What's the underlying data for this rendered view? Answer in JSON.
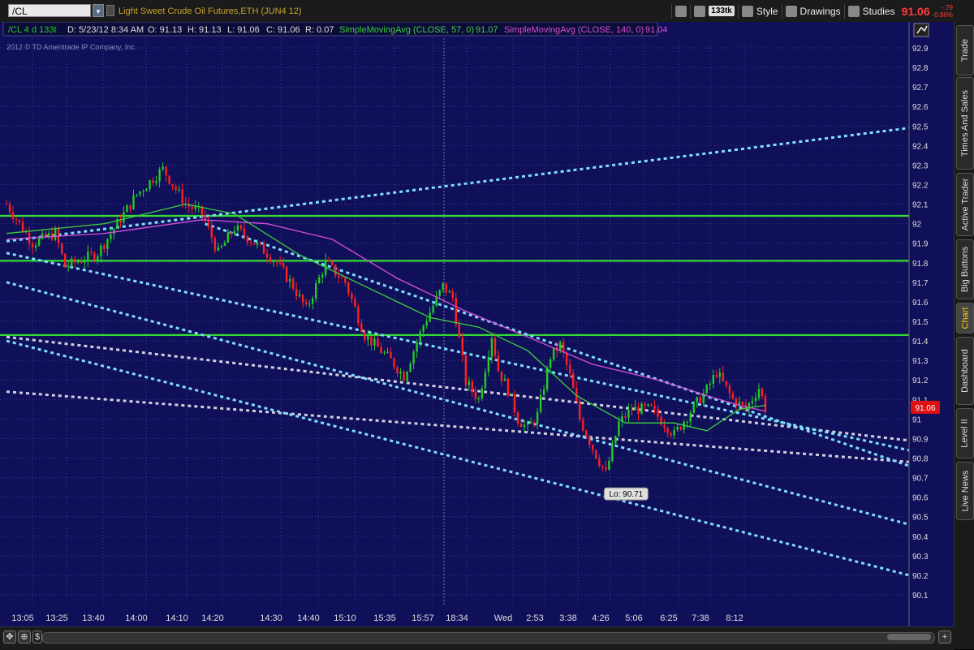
{
  "header": {
    "symbol": "/CL",
    "description": "Light Sweet Crude Oil Futures,ETH (JUN4 12)",
    "tick_badge": "133tk",
    "style_label": "Style",
    "drawings_label": "Drawings",
    "studies_label": "Studies",
    "last_price": "91.06",
    "change_abs": "-.79",
    "change_pct": "-0.86%"
  },
  "infobar": {
    "symbol_period": "/CL 4 d 133t",
    "date": "D: 5/23/12 8:34 AM",
    "open": "O: 91.13",
    "high": "H: 91.13",
    "low": "L: 91.06",
    "close": "C: 91.06",
    "range": "R: 0.07",
    "sma1_label": "SimpleMovingAvg (CLOSE, 57, 0)",
    "sma1_value": "91.07",
    "sma2_label": "SimpleMovingAvg (CLOSE, 140, 0)",
    "sma2_value": "91.04"
  },
  "copyright": "2012 © TD Ameritrade IP Company, Inc.",
  "sidebar": {
    "tabs": [
      "Trade",
      "Times And Sales",
      "Active Trader",
      "Big Buttons",
      "Chart",
      "Dashboard",
      "Level II",
      "Live News"
    ],
    "active": "Chart"
  },
  "colors": {
    "background": "#10105a",
    "grid": "#3a3a8a",
    "up": "#22cc22",
    "down": "#ff2020",
    "sma1": "#3ccf3c",
    "sma2": "#d64fd6",
    "support": "#33dd33",
    "trend_cyan": "#7fdfff",
    "trend_white": "#d0d0e0"
  },
  "chart_data": {
    "type": "candlestick",
    "ylim": [
      90.05,
      92.95
    ],
    "y_ticks": [
      92.9,
      92.8,
      92.7,
      92.6,
      92.5,
      92.4,
      92.3,
      92.2,
      92.1,
      92,
      91.9,
      91.8,
      91.7,
      91.6,
      91.5,
      91.4,
      91.3,
      91.2,
      91.1,
      91,
      90.9,
      90.8,
      90.7,
      90.6,
      90.5,
      90.4,
      90.3,
      90.2,
      90.1
    ],
    "y_tick_labels": [
      "92.9",
      "92.8",
      "92.7",
      "92.6",
      "92.5",
      "92.4",
      "92.3",
      "92.2",
      "92.1",
      "92",
      "91.9",
      "91.8",
      "91.7",
      "91.6",
      "91.5",
      "91.4",
      "91.3",
      "91.2",
      "91.1",
      "91",
      "90.9",
      "90.8",
      "90.7",
      "90.6",
      "90.5",
      "90.4",
      "90.3",
      "90.2",
      "90.1"
    ],
    "x_tick_labels": [
      "13:05",
      "13:25",
      "13:40",
      "14:00",
      "14:10",
      "14:20",
      "14:30",
      "14:40",
      "15:10",
      "15:35",
      "15:57",
      "18:34",
      "Wed",
      "2:53",
      "3:38",
      "4:26",
      "5:06",
      "6:25",
      "7:38",
      "8:12"
    ],
    "bar_count": 234,
    "path_points": [
      [
        0,
        92.1
      ],
      [
        8,
        91.9
      ],
      [
        15,
        91.95
      ],
      [
        18,
        91.78
      ],
      [
        28,
        91.85
      ],
      [
        40,
        92.15
      ],
      [
        48,
        92.28
      ],
      [
        55,
        92.1
      ],
      [
        60,
        92.05
      ],
      [
        65,
        91.85
      ],
      [
        70,
        91.98
      ],
      [
        80,
        91.85
      ],
      [
        83,
        91.8
      ],
      [
        88,
        91.68
      ],
      [
        92,
        91.56
      ],
      [
        98,
        91.8
      ],
      [
        104,
        91.7
      ],
      [
        110,
        91.43
      ],
      [
        118,
        91.3
      ],
      [
        122,
        91.22
      ],
      [
        128,
        91.48
      ],
      [
        134,
        91.68
      ],
      [
        137,
        91.62
      ],
      [
        141,
        91.19
      ],
      [
        145,
        91.1
      ],
      [
        149,
        91.43
      ],
      [
        151,
        91.25
      ],
      [
        154,
        91.15
      ],
      [
        157,
        91.0
      ],
      [
        160,
        90.95
      ],
      [
        163,
        91.02
      ],
      [
        167,
        91.32
      ],
      [
        170,
        91.38
      ],
      [
        173,
        91.22
      ],
      [
        176,
        91.0
      ],
      [
        180,
        90.85
      ],
      [
        184,
        90.72
      ],
      [
        188,
        90.98
      ],
      [
        192,
        91.05
      ],
      [
        198,
        91.05
      ],
      [
        205,
        90.92
      ],
      [
        210,
        91.04
      ],
      [
        215,
        91.15
      ],
      [
        218,
        91.24
      ],
      [
        223,
        91.1
      ],
      [
        227,
        91.05
      ],
      [
        231,
        91.16
      ],
      [
        233,
        91.06
      ]
    ],
    "sma1": {
      "name": "SimpleMovingAvg (CLOSE, 57, 0)",
      "points": [
        [
          0,
          91.95
        ],
        [
          30,
          92.0
        ],
        [
          55,
          92.1
        ],
        [
          70,
          92.05
        ],
        [
          90,
          91.84
        ],
        [
          110,
          91.68
        ],
        [
          130,
          91.52
        ],
        [
          145,
          91.47
        ],
        [
          160,
          91.35
        ],
        [
          175,
          91.12
        ],
        [
          190,
          90.98
        ],
        [
          205,
          90.98
        ],
        [
          215,
          90.94
        ],
        [
          225,
          91.05
        ],
        [
          233,
          91.07
        ]
      ]
    },
    "sma2": {
      "name": "SimpleMovingAvg (CLOSE, 140, 0)",
      "points": [
        [
          0,
          91.92
        ],
        [
          30,
          91.95
        ],
        [
          60,
          92.02
        ],
        [
          80,
          92.0
        ],
        [
          100,
          91.92
        ],
        [
          120,
          91.72
        ],
        [
          140,
          91.56
        ],
        [
          160,
          91.42
        ],
        [
          180,
          91.28
        ],
        [
          200,
          91.2
        ],
        [
          215,
          91.12
        ],
        [
          225,
          91.07
        ],
        [
          233,
          91.04
        ]
      ]
    },
    "horizontal_lines": [
      92.04,
      91.81,
      91.43
    ],
    "trend_lines_cyan": [
      [
        [
          0,
          91.91
        ],
        [
          282,
          92.49
        ]
      ],
      [
        [
          0,
          91.85
        ],
        [
          282,
          90.84
        ]
      ],
      [
        [
          0,
          91.7
        ],
        [
          282,
          90.46
        ]
      ],
      [
        [
          0,
          91.4
        ],
        [
          282,
          90.2
        ]
      ],
      [
        [
          62,
          92.0
        ],
        [
          282,
          90.76
        ]
      ]
    ],
    "trend_lines_white": [
      [
        [
          0,
          91.42
        ],
        [
          282,
          90.89
        ]
      ],
      [
        [
          0,
          91.14
        ],
        [
          282,
          90.78
        ]
      ]
    ],
    "x_span": 282,
    "annotation": {
      "text": "Lo: 90.71",
      "x": 184,
      "y": 90.71
    }
  }
}
